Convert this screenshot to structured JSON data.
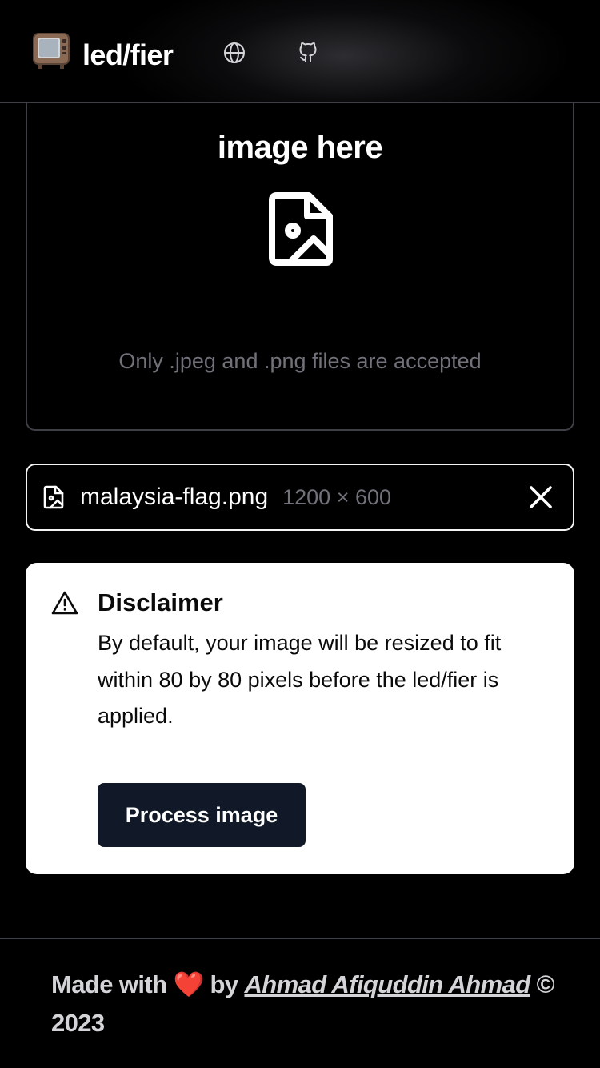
{
  "header": {
    "logo_emoji": "📺",
    "brand": "led/fier",
    "nav_icons": [
      "globe-icon",
      "github-icon"
    ]
  },
  "dropzone": {
    "title": "image here",
    "icon": "file-image-icon",
    "hint": "Only .jpeg and .png files are accepted"
  },
  "file": {
    "icon": "file-image-icon",
    "name": "malaysia-flag.png",
    "dimensions": "1200 × 600",
    "remove_icon": "close-icon"
  },
  "disclaimer": {
    "icon": "warning-triangle-icon",
    "title": "Disclaimer",
    "body": "By default, your image will be resized to fit within 80 by 80 pixels before the led/fier is applied.",
    "button_label": "Process image"
  },
  "footer": {
    "made_with": "Made with",
    "heart": "❤️",
    "by": "by",
    "author": "Ahmad Afiquddin Ahmad",
    "copyright": "©",
    "year": "2023"
  },
  "colors": {
    "background": "#000000",
    "border": "#3f3f46",
    "muted_text": "#71717a",
    "button": "#111827",
    "card": "#ffffff"
  }
}
